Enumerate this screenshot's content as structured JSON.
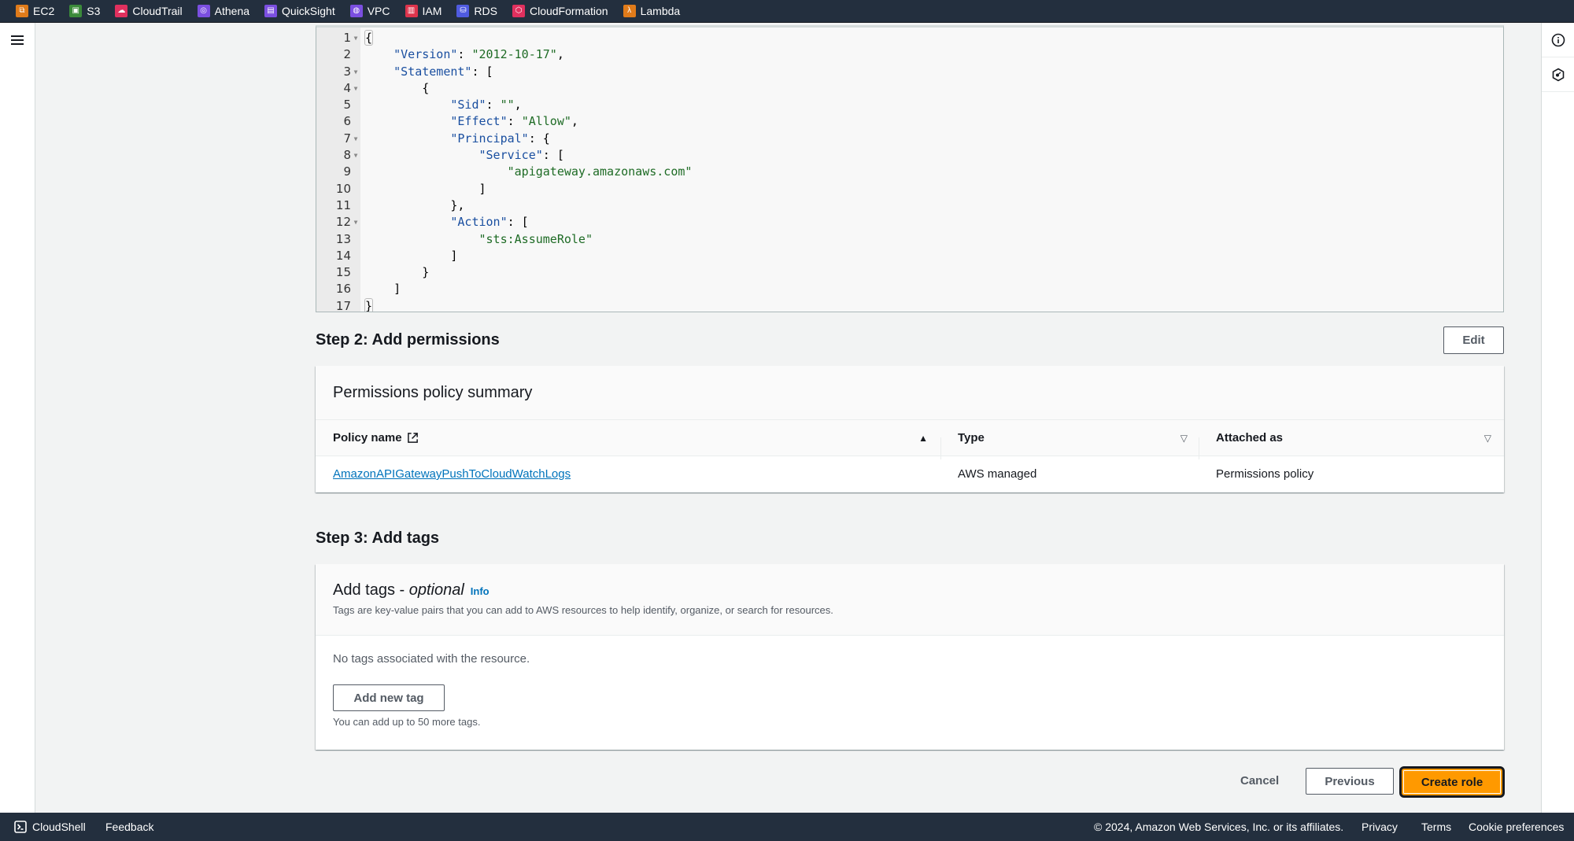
{
  "topbar": {
    "services": [
      {
        "label": "EC2",
        "icon": "ec2-icon",
        "color": "#e07b1a"
      },
      {
        "label": "S3",
        "icon": "s3-icon",
        "color": "#3b8a3a"
      },
      {
        "label": "CloudTrail",
        "icon": "cloudtrail-icon",
        "color": "#e0305e"
      },
      {
        "label": "Athena",
        "icon": "athena-icon",
        "color": "#7b4fe0"
      },
      {
        "label": "QuickSight",
        "icon": "quicksight-icon",
        "color": "#7b4fe0"
      },
      {
        "label": "VPC",
        "icon": "vpc-icon",
        "color": "#7b4fe0"
      },
      {
        "label": "IAM",
        "icon": "iam-icon",
        "color": "#dd344c"
      },
      {
        "label": "RDS",
        "icon": "rds-icon",
        "color": "#4f5be0"
      },
      {
        "label": "CloudFormation",
        "icon": "cloudformation-icon",
        "color": "#e0305e"
      },
      {
        "label": "Lambda",
        "icon": "lambda-icon",
        "color": "#e07b1a"
      }
    ]
  },
  "editor": {
    "lines": [
      {
        "n": "1",
        "fold": true
      },
      {
        "n": "2",
        "fold": false
      },
      {
        "n": "3",
        "fold": true
      },
      {
        "n": "4",
        "fold": true
      },
      {
        "n": "5",
        "fold": false
      },
      {
        "n": "6",
        "fold": false
      },
      {
        "n": "7",
        "fold": true
      },
      {
        "n": "8",
        "fold": true
      },
      {
        "n": "9",
        "fold": false
      },
      {
        "n": "10",
        "fold": false
      },
      {
        "n": "11",
        "fold": false
      },
      {
        "n": "12",
        "fold": true
      },
      {
        "n": "13",
        "fold": false
      },
      {
        "n": "14",
        "fold": false
      },
      {
        "n": "15",
        "fold": false
      },
      {
        "n": "16",
        "fold": false
      },
      {
        "n": "17",
        "fold": false
      }
    ],
    "policy": {
      "version_key": "\"Version\"",
      "version_val": "\"2012-10-17\"",
      "statement_key": "\"Statement\"",
      "sid_key": "\"Sid\"",
      "sid_val": "\"\"",
      "effect_key": "\"Effect\"",
      "effect_val": "\"Allow\"",
      "principal_key": "\"Principal\"",
      "service_key": "\"Service\"",
      "service_val": "\"apigateway.amazonaws.com\"",
      "action_key": "\"Action\"",
      "action_val": "\"sts:AssumeRole\""
    }
  },
  "step2": {
    "heading": "Step 2: Add permissions",
    "edit_label": "Edit",
    "card_title": "Permissions policy summary",
    "columns": [
      "Policy name",
      "Type",
      "Attached as"
    ],
    "rows": [
      {
        "policy_name": "AmazonAPIGatewayPushToCloudWatchLogs",
        "type": "AWS managed",
        "attached_as": "Permissions policy"
      }
    ]
  },
  "step3": {
    "heading": "Step 3: Add tags",
    "card_title_prefix": "Add tags - ",
    "card_title_optional": "optional",
    "info_label": "Info",
    "description": "Tags are key-value pairs that you can add to AWS resources to help identify, organize, or search for resources.",
    "empty_text": "No tags associated with the resource.",
    "add_tag_label": "Add new tag",
    "limit_text": "You can add up to 50 more tags."
  },
  "actions": {
    "cancel_label": "Cancel",
    "previous_label": "Previous",
    "create_label": "Create role"
  },
  "footer": {
    "cloudshell_label": "CloudShell",
    "feedback_label": "Feedback",
    "copyright": "© 2024, Amazon Web Services, Inc. or its affiliates.",
    "privacy_label": "Privacy",
    "terms_label": "Terms",
    "cookie_label": "Cookie preferences"
  }
}
